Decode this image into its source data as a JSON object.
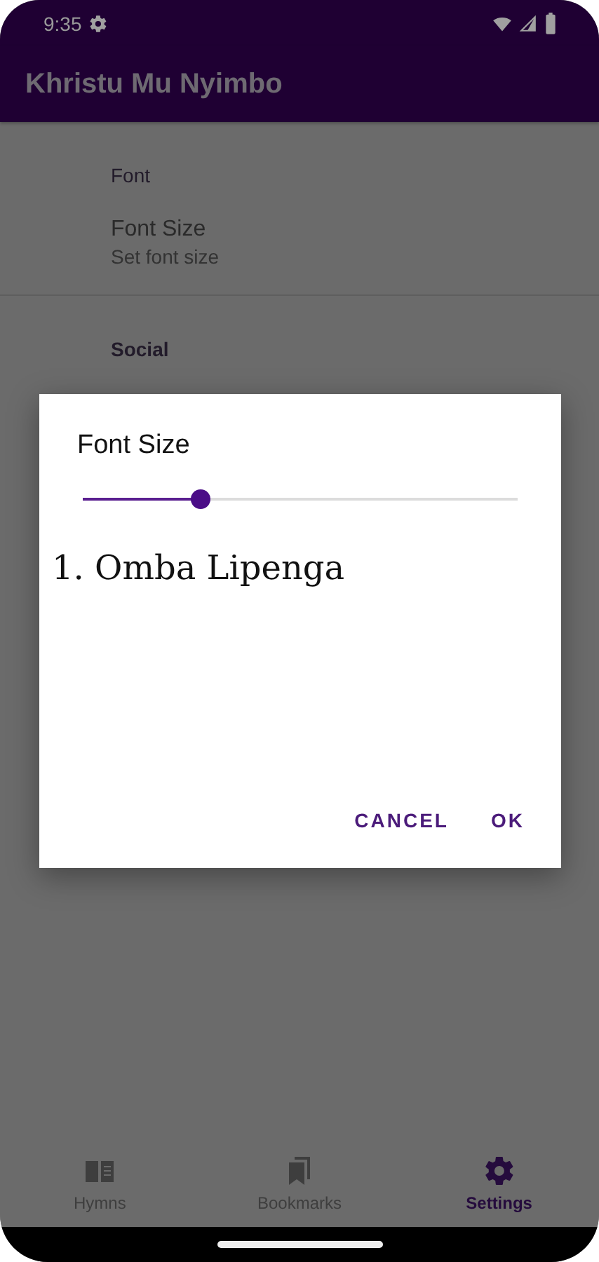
{
  "status_bar": {
    "time": "9:35"
  },
  "app_bar": {
    "title": "Khristu Mu Nyimbo"
  },
  "sections": [
    {
      "header": "Font",
      "items": [
        {
          "title": "Font Size",
          "subtitle": "Set font size"
        }
      ]
    },
    {
      "header": "Social"
    }
  ],
  "dialog": {
    "title": "Font Size",
    "slider": {
      "level": 0.28
    },
    "preview": "1. Omba Lipenga",
    "buttons": [
      "CANCEL",
      "OK"
    ]
  },
  "bottom_nav": [
    {
      "label": "Hymns",
      "selected": false
    },
    {
      "label": "Bookmarks",
      "selected": false
    },
    {
      "label": "Settings",
      "selected": true
    }
  ]
}
